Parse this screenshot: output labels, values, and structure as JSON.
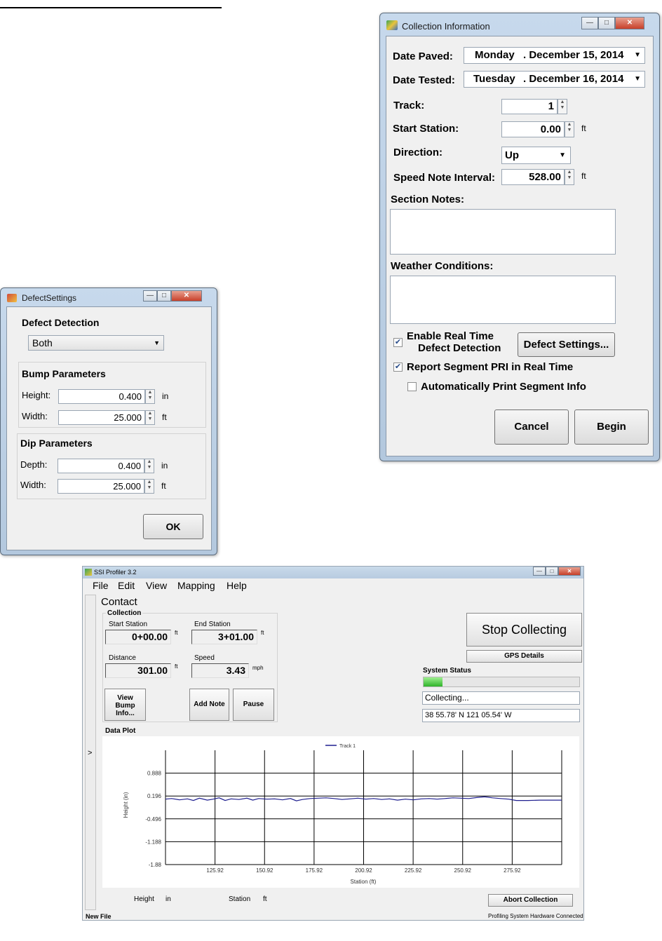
{
  "collection_info": {
    "title": "Collection Information",
    "date_paved_label": "Date Paved:",
    "date_paved_day": "Monday",
    "date_paved_date": ". December 15, 2014",
    "date_tested_label": "Date Tested:",
    "date_tested_day": "Tuesday",
    "date_tested_date": ". December 16, 2014",
    "track_label": "Track:",
    "track_value": "1",
    "start_station_label": "Start Station:",
    "start_station_value": "0.00",
    "start_station_unit": "ft",
    "direction_label": "Direction:",
    "direction_value": "Up",
    "speed_note_label": "Speed Note Interval:",
    "speed_note_value": "528.00",
    "speed_note_unit": "ft",
    "section_notes_label": "Section Notes:",
    "section_notes_value": "",
    "weather_label": "Weather Conditions:",
    "weather_value": "",
    "realtime_label_1": "Enable Real Time",
    "realtime_label_2": "Defect Detection",
    "realtime_checked": true,
    "defect_settings_button": "Defect Settings...",
    "report_pri_label": "Report Segment PRI in Real Time",
    "report_pri_checked": true,
    "auto_print_label": "Automatically Print Segment Info",
    "auto_print_checked": false,
    "cancel_button": "Cancel",
    "begin_button": "Begin"
  },
  "defect_settings": {
    "title": "DefectSettings",
    "detection_heading": "Defect Detection",
    "detection_value": "Both",
    "bump_heading": "Bump Parameters",
    "bump_height_label": "Height:",
    "bump_height_value": "0.400",
    "bump_height_unit": "in",
    "bump_width_label": "Width:",
    "bump_width_value": "25.000",
    "bump_width_unit": "ft",
    "dip_heading": "Dip Parameters",
    "dip_depth_label": "Depth:",
    "dip_depth_value": "0.400",
    "dip_depth_unit": "in",
    "dip_width_label": "Width:",
    "dip_width_value": "25.000",
    "dip_width_unit": "ft",
    "ok_button": "OK"
  },
  "profiler": {
    "title": "SSI Profiler 3.2",
    "menu": [
      "File",
      "Edit",
      "View",
      "Mapping",
      "Help"
    ],
    "contact_label": "Contact",
    "collection_label": "Collection",
    "start_station_label": "Start Station",
    "start_station_value": "0+00.00",
    "end_station_label": "End Station",
    "end_station_value": "3+01.00",
    "distance_label": "Distance",
    "distance_value": "301.00",
    "speed_label": "Speed",
    "speed_value": "3.43",
    "unit_ft": "ft",
    "unit_mph": "mph",
    "view_bump_1": "View",
    "view_bump_2": "Bump",
    "view_bump_3": "Info...",
    "add_note_button": "Add Note",
    "pause_button": "Pause",
    "stop_collecting_button": "Stop Collecting",
    "gps_details_button": "GPS Details",
    "system_status_label": "System Status",
    "system_progress": 0.12,
    "status_text": "Collecting...",
    "gps_coords": "38 55.78' N 121 05.54' W",
    "data_plot_label": "Data Plot",
    "side_toggle": ">",
    "footer_height_label": "Height",
    "footer_height_unit": "in",
    "footer_station_label": "Station",
    "footer_station_unit": "ft",
    "abort_button": "Abort Collection",
    "status_left": "New File",
    "status_right": "Profiling System Hardware Connected"
  },
  "chart_data": {
    "type": "line",
    "title": "",
    "xlabel": "Station (ft)",
    "ylabel": "Height (in)",
    "x_ticks": [
      "125.92",
      "150.92",
      "175.92",
      "200.92",
      "225.92",
      "250.92",
      "275.92"
    ],
    "y_ticks": [
      "0.888",
      "0.196",
      "-0.496",
      "-1.188",
      "-1.88"
    ],
    "xlim": [
      100.92,
      300.92
    ],
    "ylim": [
      -1.88,
      1.58
    ],
    "series": [
      {
        "name": "Track 1",
        "color": "#1f1f8f",
        "x": [
          100.92,
          104,
          108,
          112,
          115,
          118,
          122,
          125,
          128,
          131,
          134,
          138,
          142,
          145,
          148,
          152,
          156,
          160,
          164,
          167,
          170,
          174,
          178,
          182,
          186,
          190,
          194,
          198,
          202,
          206,
          210,
          214,
          218,
          222,
          226,
          230,
          234,
          238,
          242,
          246,
          250,
          254,
          258,
          262,
          266,
          270,
          274,
          278,
          284,
          290,
          296,
          300.92
        ],
        "values": [
          0.1,
          0.12,
          0.08,
          0.11,
          0.06,
          0.13,
          0.07,
          0.1,
          0.14,
          0.06,
          0.11,
          0.09,
          0.13,
          0.07,
          0.12,
          0.1,
          0.11,
          0.08,
          0.12,
          0.05,
          0.09,
          0.12,
          0.13,
          0.14,
          0.12,
          0.09,
          0.11,
          0.13,
          0.1,
          0.12,
          0.09,
          0.11,
          0.07,
          0.1,
          0.08,
          0.11,
          0.12,
          0.1,
          0.12,
          0.14,
          0.13,
          0.12,
          0.15,
          0.17,
          0.14,
          0.12,
          0.1,
          0.06,
          0.06,
          0.07,
          0.07,
          0.07
        ]
      }
    ]
  }
}
